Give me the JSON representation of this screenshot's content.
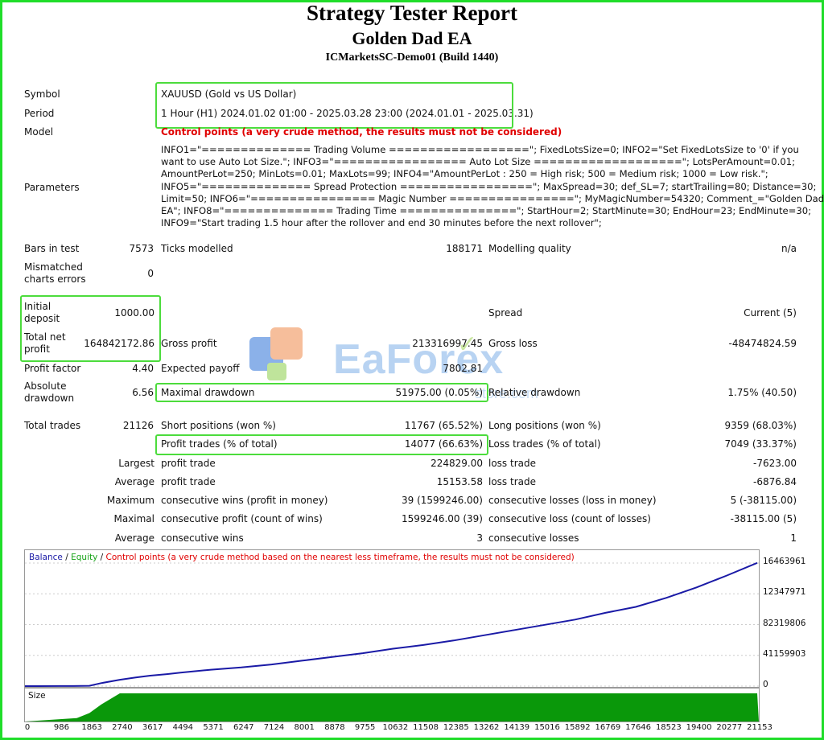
{
  "header": {
    "title": "Strategy Tester Report",
    "ea_name": "Golden Dad EA",
    "server": "ICMarketsSC-Demo01 (Build 1440)"
  },
  "symbol": {
    "label": "Symbol",
    "value": "XAUUSD (Gold vs US Dollar)"
  },
  "period": {
    "label": "Period",
    "value": "1 Hour (H1) 2024.01.02 01:00 - 2025.03.28 23:00 (2024.01.01 - 2025.03.31)"
  },
  "model": {
    "label": "Model",
    "value": "Control points (a very crude method, the results must not be considered)"
  },
  "parameters": {
    "label": "Parameters",
    "lines": [
      "INFO1=\"============== Trading Volume ==================\"; FixedLotsSize=0; INFO2=\"Set FixedLotsSize to '0' if you",
      "want to use Auto Lot Size.\"; INFO3=\"================= Auto Lot Size ===================\"; LotsPerAmount=0.01;",
      "AmountPerLot=250; MinLots=0.01; MaxLots=99; INFO4=\"AmountPerLot : 250 = High risk; 500 = Medium risk; 1000 = Low risk.\";",
      "INFO5=\"============== Spread Protection =================\"; MaxSpread=30; def_SL=7; startTrailing=80; Distance=30;",
      "Limit=50; INFO6=\"================ Magic Number ================\"; MyMagicNumber=54320; Comment_=\"Golden Dad",
      "EA\"; INFO8=\"============== Trading Time ===============\"; StartHour=2; StartMinute=30; EndHour=23; EndMinute=30;",
      "INFO9=\"Start trading 1.5 hour after the rollover and end 30 minutes before the next rollover\";"
    ]
  },
  "stats": {
    "bars_label": "Bars in test",
    "bars": "7573",
    "ticks_label": "Ticks modelled",
    "ticks": "188171",
    "quality_label": "Modelling quality",
    "quality": "n/a",
    "mismatch_label_1": "Mismatched",
    "mismatch_label_2": "charts errors",
    "mismatch": "0",
    "deposit_label_1": "Initial",
    "deposit_label_2": "deposit",
    "deposit": "1000.00",
    "spread_label": "Spread",
    "spread": "Current (5)",
    "net_label_1": "Total net",
    "net_label_2": "profit",
    "net": "164842172.86",
    "gross_profit_label": "Gross profit",
    "gross_profit": "213316997.45",
    "gross_loss_label": "Gross loss",
    "gross_loss": "-48474824.59",
    "pf_label": "Profit factor",
    "pf": "4.40",
    "ep_label": "Expected payoff",
    "ep": "7802.81",
    "abs_dd_label_1": "Absolute",
    "abs_dd_label_2": "drawdown",
    "abs_dd": "6.56",
    "max_dd_label": "Maximal drawdown",
    "max_dd": "51975.00 (0.05%)",
    "rel_dd_label": "Relative drawdown",
    "rel_dd": "1.75% (40.50)",
    "trades_label": "Total trades",
    "trades": "21126",
    "short_label": "Short positions (won %)",
    "short": "11767 (65.52%)",
    "long_label": "Long positions (won %)",
    "long": "9359 (68.03%)",
    "pt_label": "Profit trades (% of total)",
    "pt": "14077 (66.63%)",
    "lt_label": "Loss trades (% of total)",
    "lt": "7049 (33.37%)",
    "largest": "Largest",
    "average": "Average",
    "maximum": "Maximum",
    "maximal": "Maximal",
    "profit_trade": "profit trade",
    "loss_trade": "loss trade",
    "largest_profit": "224829.00",
    "largest_loss": "-7623.00",
    "avg_profit": "15153.58",
    "avg_loss": "-6876.84",
    "cw_money_label": "consecutive wins (profit in money)",
    "cw_money": "39 (1599246.00)",
    "cl_money_label": "consecutive losses (loss in money)",
    "cl_money": "5 (-38115.00)",
    "cp_count_label": "consecutive profit (count of wins)",
    "cp_count": "1599246.00 (39)",
    "cl_count_label": "consecutive loss (count of losses)",
    "cl_count": "-38115.00 (5)",
    "avg_wins_label": "consecutive wins",
    "avg_wins": "3",
    "avg_losses_label": "consecutive losses",
    "avg_losses": "1"
  },
  "watermark": {
    "text": "EaForex",
    "sub": "store.com"
  },
  "chart_data": {
    "type": "line",
    "legend": {
      "balance": "Balance",
      "sep1": " / ",
      "equity": "Equity",
      "sep2": " / ",
      "control": "Control points (a very crude method based on the nearest less timeframe, the results must not be considered)"
    },
    "colors": {
      "balance": "#1a1aa6",
      "equity": "#18a318",
      "control": "#e00000",
      "size": "#0a980a"
    },
    "y_ticks": [
      "164639610",
      "123479710",
      "82319806",
      "41159903",
      "0"
    ],
    "y_tick_labels": [
      "16463961",
      "12347971",
      "82319806",
      "41159903",
      "0"
    ],
    "ylim": [
      0,
      164639610
    ],
    "xlim": [
      0,
      21153
    ],
    "x_ticks": [
      "0",
      "986",
      "1863",
      "2740",
      "3617",
      "4494",
      "5371",
      "6247",
      "7124",
      "8001",
      "8878",
      "9755",
      "10632",
      "11508",
      "12385",
      "13262",
      "14139",
      "15016",
      "15892",
      "16769",
      "17646",
      "18523",
      "19400",
      "20277",
      "21153"
    ],
    "series": [
      {
        "name": "Balance",
        "x": [
          0,
          400,
          986,
          1400,
          1863,
          2200,
          2740,
          3200,
          3617,
          4100,
          4494,
          5371,
          6247,
          7124,
          8001,
          8878,
          9755,
          10632,
          11508,
          12385,
          13262,
          14139,
          15016,
          15892,
          16769,
          17646,
          18523,
          19400,
          20277,
          21153
        ],
        "y": [
          1000,
          30000,
          80000,
          150000,
          400000,
          4000000,
          8500000,
          11500000,
          14000000,
          16000000,
          18000000,
          22000000,
          25000000,
          29000000,
          34000000,
          39000000,
          44000000,
          50000000,
          55000000,
          61000000,
          68000000,
          75000000,
          82000000,
          89000000,
          98000000,
          106000000,
          118000000,
          132000000,
          148000000,
          164842172
        ]
      }
    ],
    "size_label": "Size",
    "size_series": {
      "x": [
        0,
        1500,
        1863,
        2200,
        2740,
        21153
      ],
      "y": [
        0,
        0.12,
        0.3,
        0.6,
        1,
        1
      ]
    }
  }
}
